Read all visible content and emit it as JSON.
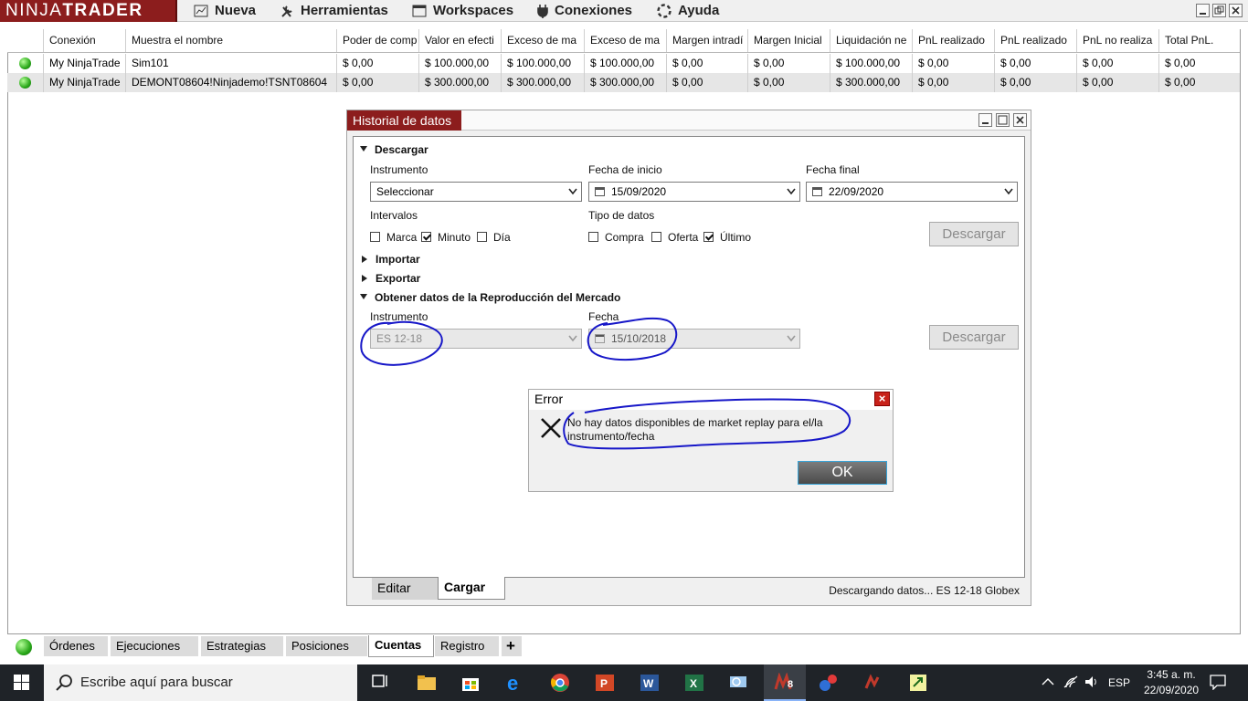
{
  "app": {
    "logo_left": "NINJA",
    "logo_right": "TRADER"
  },
  "menu": [
    {
      "label": "Nueva",
      "icon": "chart-icon"
    },
    {
      "label": "Herramientas",
      "icon": "wrench-icon"
    },
    {
      "label": "Workspaces",
      "icon": "window-icon"
    },
    {
      "label": "Conexiones",
      "icon": "plug-icon"
    },
    {
      "label": "Ayuda",
      "icon": "lifebuoy-icon"
    }
  ],
  "grid": {
    "columns": [
      "",
      "Conexión",
      "Muestra el nombre",
      "Poder de comp",
      "Valor en efecti",
      "Exceso de ma",
      "Exceso de ma",
      "Margen intradí",
      "Margen Inicial",
      "Liquidación ne",
      "PnL realizado",
      "PnL realizado",
      "PnL no realiza",
      "Total PnL."
    ],
    "rows": [
      [
        "",
        "My NinjaTrade",
        "Sim101",
        "$ 0,00",
        "$ 100.000,00",
        "$ 100.000,00",
        "$ 100.000,00",
        "$ 0,00",
        "$ 0,00",
        "$ 100.000,00",
        "$ 0,00",
        "$ 0,00",
        "$ 0,00",
        "$ 0,00"
      ],
      [
        "",
        "My NinjaTrade",
        "DEMONT08604!Ninjademo!TSNT08604",
        "$ 0,00",
        "$ 300.000,00",
        "$ 300.000,00",
        "$ 300.000,00",
        "$ 0,00",
        "$ 0,00",
        "$ 300.000,00",
        "$ 0,00",
        "$ 0,00",
        "$ 0,00",
        "$ 0,00"
      ]
    ]
  },
  "history": {
    "title": "Historial de datos",
    "download": {
      "section": "Descargar",
      "instrument_label": "Instrumento",
      "instrument_value": "Seleccionar",
      "start_label": "Fecha de inicio",
      "start_value": "15/09/2020",
      "end_label": "Fecha final",
      "end_value": "22/09/2020",
      "intervals_label": "Intervalos",
      "intervals": [
        {
          "label": "Marca",
          "checked": false
        },
        {
          "label": "Minuto",
          "checked": true
        },
        {
          "label": "Día",
          "checked": false
        }
      ],
      "types_label": "Tipo de datos",
      "types": [
        {
          "label": "Compra",
          "checked": false
        },
        {
          "label": "Oferta",
          "checked": false
        },
        {
          "label": "Último",
          "checked": true
        }
      ],
      "button": "Descargar"
    },
    "import": "Importar",
    "export": "Exportar",
    "replay": {
      "section": "Obtener datos de la Reproducción del Mercado",
      "instrument_label": "Instrumento",
      "instrument_value": "ES 12-18",
      "date_label": "Fecha",
      "date_value": "15/10/2018",
      "button": "Descargar"
    },
    "tabs": [
      "Editar",
      "Cargar"
    ],
    "status": "Descargando datos... ES 12-18 Globex"
  },
  "error": {
    "title": "Error",
    "message_line1": "No hay datos disponibles de market replay para el/la",
    "message_line2": "instrumento/fecha",
    "ok": "OK"
  },
  "bottom_tabs": [
    "Órdenes",
    "Ejecuciones",
    "Estrategias",
    "Posiciones",
    "Cuentas",
    "Registro",
    "+"
  ],
  "taskbar": {
    "search_placeholder": "Escribe aquí para buscar",
    "lang": "ESP",
    "time": "3:45 a. m.",
    "date": "22/09/2020",
    "badge": "8"
  },
  "colors": {
    "brand": "#8c1d1d",
    "ink": "#1717c8",
    "led": "#2aa81a"
  }
}
